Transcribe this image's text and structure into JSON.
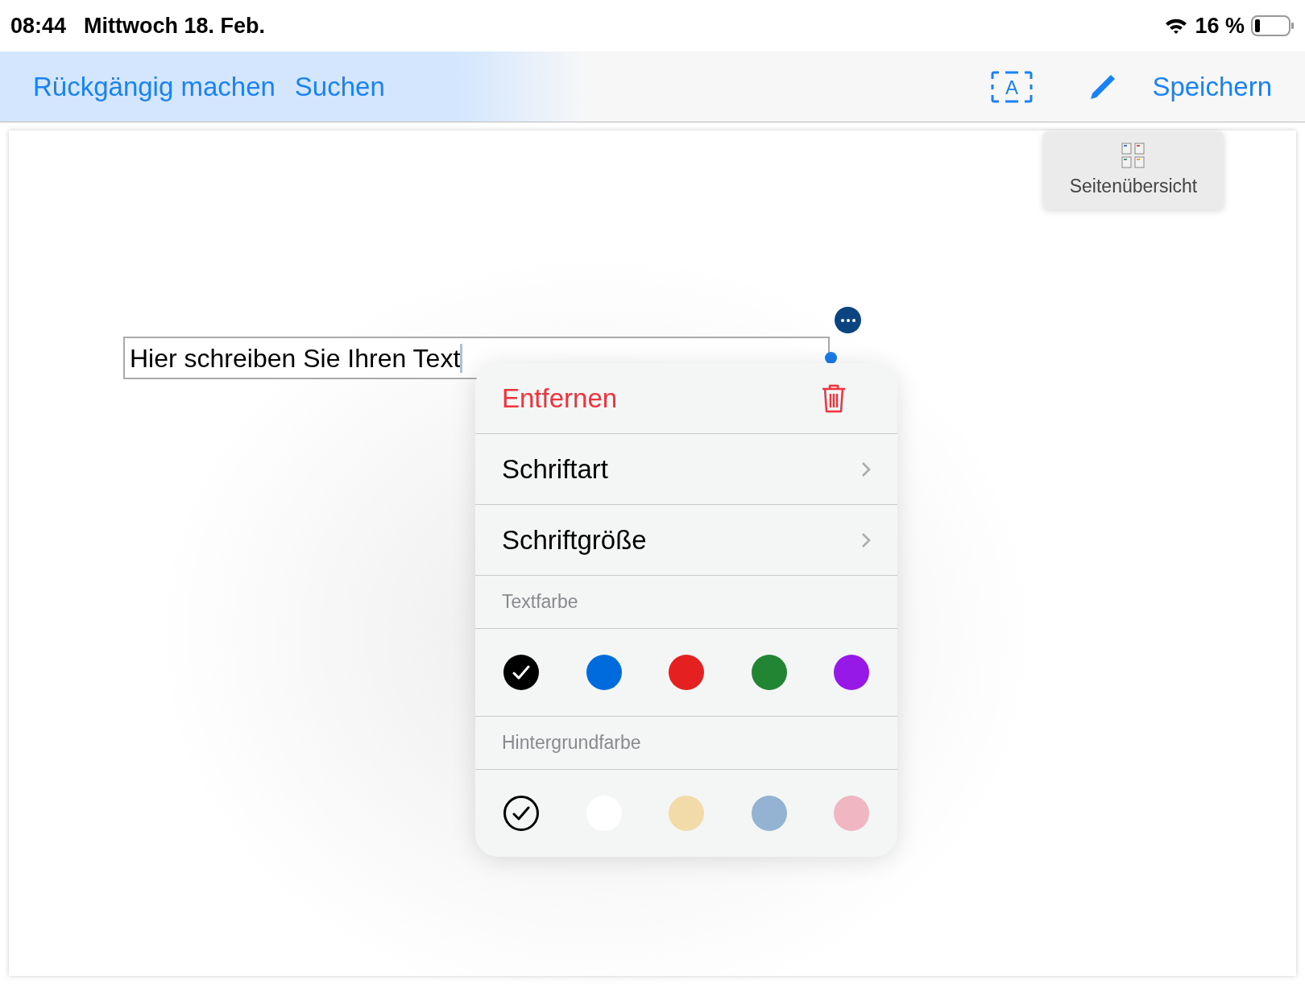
{
  "status_bar": {
    "time": "08:44",
    "date": "Mittwoch 18. Feb.",
    "battery": "16 %"
  },
  "toolbar": {
    "left": [
      "Rückgängig machen",
      "Suchen"
    ],
    "save": "Speichern",
    "text_tool_letter": "A"
  },
  "page_overview": {
    "label": "Seitenübersicht"
  },
  "text_box": {
    "value": "Hier schreiben Sie Ihren Text"
  },
  "menu": {
    "remove": "Entfernen",
    "items": [
      "Schriftart",
      "Schriftgröße"
    ],
    "text_color": {
      "label": "Textfarbe",
      "swatches": [
        {
          "kind": "swatch",
          "color": "#000000",
          "selected": true
        },
        {
          "kind": "swatch",
          "color": "#006bdc",
          "selected": false
        },
        {
          "kind": "swatch",
          "color": "#e52020",
          "selected": false
        },
        {
          "kind": "swatch",
          "color": "#218534",
          "selected": false
        },
        {
          "kind": "swatch",
          "color": "#9619e8",
          "selected": false
        }
      ]
    },
    "background_color": {
      "label": "Hintergrundfarbe",
      "swatches": [
        {
          "kind": "none",
          "selected": true
        },
        {
          "kind": "swatch",
          "color": "#ffffff",
          "selected": false
        },
        {
          "kind": "swatch",
          "color": "#f2daa9",
          "selected": false
        },
        {
          "kind": "swatch",
          "color": "#94b3d3",
          "selected": false
        },
        {
          "kind": "swatch",
          "color": "#f0b6c2",
          "selected": false
        }
      ]
    }
  }
}
